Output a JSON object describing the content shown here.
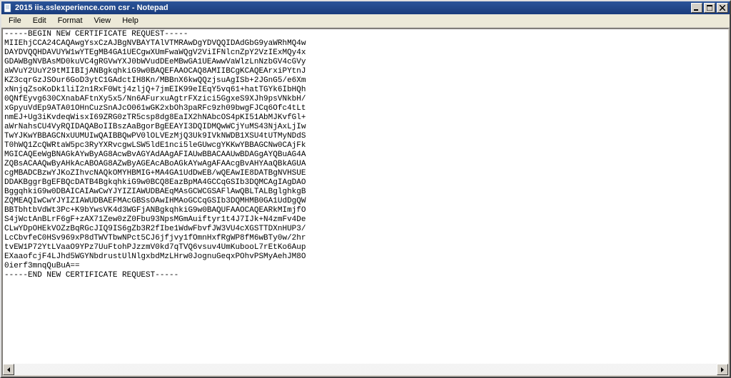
{
  "window": {
    "title": "2015 iis.sslexperience.com csr - Notepad"
  },
  "menu": {
    "file": "File",
    "edit": "Edit",
    "format": "Format",
    "view": "View",
    "help": "Help"
  },
  "content": {
    "text": "-----BEGIN NEW CERTIFICATE REQUEST-----\nMIIEhjCCA24CAQAwgYsxCzAJBgNVBAYTAlVTMRAwDgYDVQQIDAdGbG9yaWRhMQ4w\nDAYDVQQHDAVUYW1wYTEgMB4GA1UECgwXUmFwaWQgV2ViIFNlcnZpY2VzIExMQy4x\nGDAWBgNVBAsMD0kuVC4gRGVwYXJ0bWVudDEeMBwGA1UEAwwVaWlzLnNzbGV4cGVy\naWVuY2UuY29tMIIBIjANBgkqhkiG9w0BAQEFAAOCAQ8AMIIBCgKCAQEArxiPYtnJ\nKZ3cqrGzJSOur6GoD3ytC1GAdctIH8Kn/MBBnX6kwQQzjsuAgISb+2JGnG5/e6Xm\nxNnjqZsoKoDk1liI2n1RxF0Wtj4zljQ+7jmEIK99eIEqY5vq61+hatTGYk6IbHQh\n0QNfEyvg630CXnabAFtnXy5x5/Nn6AFurxuAgtrFXzici5GgxeS9XJh9psVNkbH/\nxGpyuVdEp9ATA01OHnCuzSnAJcO061wGK2xbOh3paRFc9zh09bwgFJCq6Ofc4tLt\nnmEJ+Ug3iKvdeqWisxI69ZRG0zTR5csp8dg8EaIX2hNAbcOS4pKI51AbMJKvfGl+\naWrNahsCU4VyRQIDAQABoIIBszAaBgorBgEEAYI3DQIDMQwWCjYuMS43NjAxLjIw\nTwYJKwYBBAGCNxUUMUIwQAIBBQwPV0lOLVEzMjQ3Uk9IVkNWDB1XSU4tUTMyNDdS\nT0hWQ1ZcQWRtaW5pc3RyYXRvcgwLSW5ldE1nci5leGUwcgYKKwYBBAGCNw0CAjFk\nMGICAQEeWgBNAGkAYwByAG8AcwBvAGYAdAAgAFIAUwBBACAAUwBDAGgAYQBuAG4A\nZQBsACAAQwByAHkAcABOAG8AZwByAGEAcABoAGkAYwAgAFAAcgBvAHYAaQBkAGUA\ncgMBADCBzwYJKoZIhvcNAQkOMYHBMIG+MA4GA1UdDwEB/wQEAwIE8DATBgNVHSUE\nDDAKBggrBgEFBQcDATB4BgkqhkiG9w0BCQ8EazBpMA4GCCqGSIb3DQMCAgIAgDAO\nBggqhkiG9w0DBAICAIAwCwYJYIZIAWUDBAEqMAsGCWCGSAFlAwQBLTALBglghkgB\nZQMEAQIwCwYJYIZIAWUDBAEFMAcGBSsOAwIHMAoGCCqGSIb3DQMHMB0GA1UdDgQW\nBBTbhtbVdWt3Pc+K9bYwsVK4d3WGFjANBgkqhkiG9w0BAQUFAAOCAQEARkMImjfO\nS4jWctAnBLrF6gF+zAX71Zew0zZ0Fbu93NpsMGmAuiftyr1t4J7IJk+N4zmFv4De\nCLwYDpOHEkVOZzBqRGcJIQ9IS6gZb3R2fIbe1WdwFbvfJW3VU4cXGSTTDXnHUP3/\nLcCbvfeC0HSv969xP8dTWVTbwNPct5CJ6jfjvy1fOmnHxfRgWP8fM6wBTy0w/2hr\ntvEW1P72YtLVaaO9YPz7UuFtohPJzzmV0kd7qTVQ6vsuv4UmKubooL7rEtKo6Aup\nEXaaofcjF4LJhd5WGYNbdrustUlNlgxbdMzLHrw0JognuGeqxPOhvPSMyAehJM8O\n0ierf3mnqQuBuA==\n-----END NEW CERTIFICATE REQUEST-----"
  }
}
